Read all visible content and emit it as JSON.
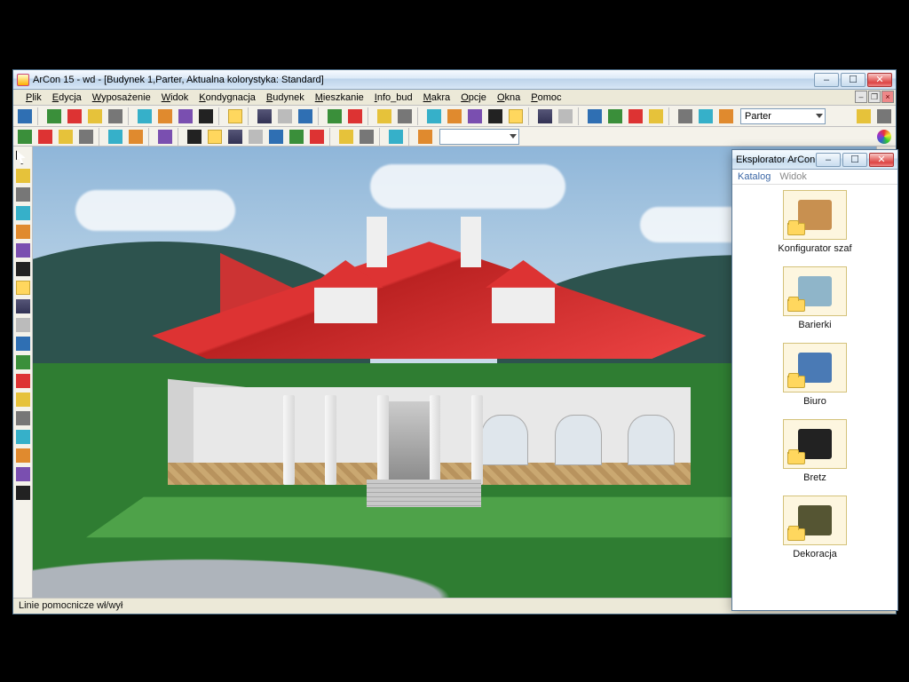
{
  "title": "ArCon 15 - wd - [Budynek 1,Parter, Aktualna kolorystyka: Standard]",
  "menus": [
    "Plik",
    "Edycja",
    "Wyposażenie",
    "Widok",
    "Kondygnacja",
    "Budynek",
    "Mieszkanie",
    "Info_bud",
    "Makra",
    "Opcje",
    "Okna",
    "Pomoc"
  ],
  "floor_combo": "Parter",
  "statusbar": "Linie pomocnicze wł/wył",
  "explorer": {
    "title": "Eksplorator ArCon",
    "menus": [
      "Katalog",
      "Widok"
    ],
    "items": [
      "Konfigurator szaf",
      "Barierki",
      "Biuro",
      "Bretz",
      "Dekoracja"
    ]
  },
  "toolbar1_icons": [
    "design-mode-icon",
    "sheet-icon",
    "open-icon",
    "save-icon",
    "undo-icon",
    "email-icon",
    "print-icon",
    "export-icon",
    "palette-icon",
    "window-icon",
    "layers-icon",
    "copy-floor-icon",
    "rotate-left-icon",
    "rotate-right-icon",
    "zoom-icon",
    "text-zoom-icon",
    "target-icon",
    "grid-dots-icon",
    "grid-icon",
    "hatch-icon",
    "hatch2-icon",
    "dark-icon",
    "green-window-icon",
    "split-red-icon",
    "split-view-icon",
    "hatchwin-icon",
    "text-abc-icon",
    "xyz-icon",
    "cross-icon",
    "wedge-icon",
    "hatch-diag-icon"
  ],
  "toolbar1_right_icons": [
    "book-icon",
    "help-icon"
  ],
  "toolbar2_icons": [
    "building-yellow-icon",
    "folder-yellow-icon",
    "new-window-icon",
    "cube-green-icon",
    "bolt-icon",
    "spark-icon",
    "dots-icon",
    "play-start-icon",
    "play-prev-icon",
    "play-stop-icon",
    "play-play-icon",
    "play-pause-icon",
    "play-next-icon",
    "play-end-icon",
    "shelf-icon",
    "door-red-icon",
    "move-icon",
    "record-icon"
  ],
  "toolbar2_extra_icon": "palette-icon",
  "lefttools_icons": [
    "cursor-icon",
    "select-rect-icon",
    "tape-icon",
    "bracket-icon",
    "x-icon",
    "lamp-icon",
    "chair-icon",
    "sofa-icon",
    "bed-icon",
    "ruler-icon",
    "mirror-h-icon",
    "mirror-v-icon",
    "sun-icon",
    "stairs-icon",
    "pencil-icon",
    "brush-icon",
    "balance-icon",
    "scanner-icon",
    "device-icon"
  ],
  "righttools_icons": [
    "folder-open-icon",
    "folder-icon",
    "filter-icon",
    "tools-rgb-icon",
    "brush-red-icon",
    "pencil-red-icon",
    "wand-icon",
    "at-icon",
    "o2c-icon",
    "grid-red-icon",
    "grid-brown-icon"
  ]
}
